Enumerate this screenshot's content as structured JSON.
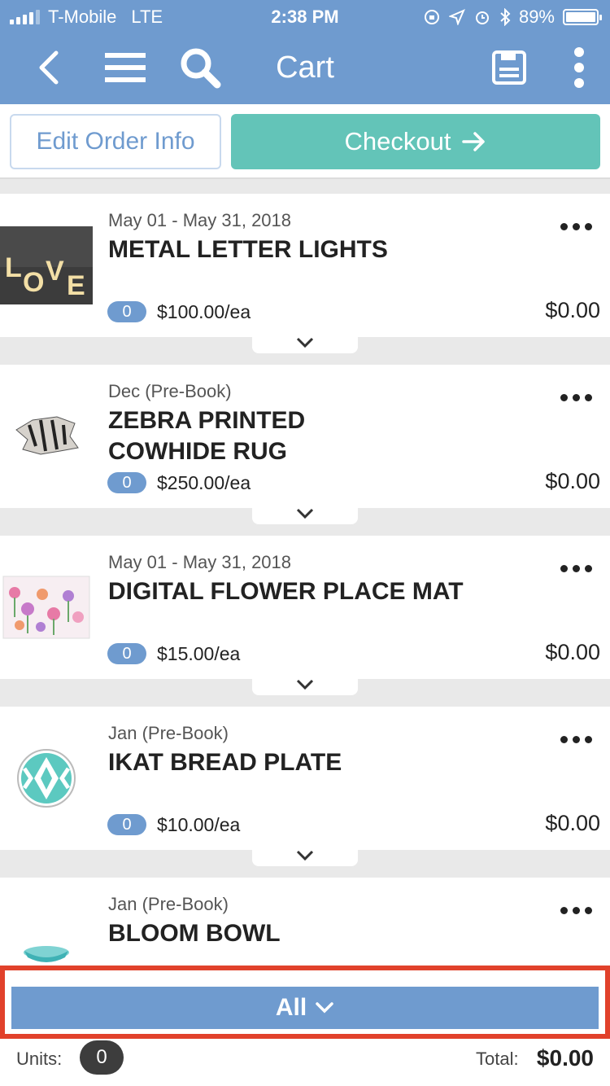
{
  "status": {
    "carrier": "T-Mobile",
    "network": "LTE",
    "time": "2:38 PM",
    "battery": "89%",
    "battery_level": 0.89
  },
  "nav": {
    "title": "Cart"
  },
  "actions": {
    "edit_label": "Edit Order Info",
    "checkout_label": "Checkout"
  },
  "items": [
    {
      "period": "May 01 - May 31, 2018",
      "name": "METAL LETTER LIGHTS",
      "qty": "0",
      "price": "$100.00/ea",
      "total": "$0.00"
    },
    {
      "period": "Dec (Pre-Book)",
      "name": "ZEBRA PRINTED COWHIDE RUG",
      "qty": "0",
      "price": "$250.00/ea",
      "total": "$0.00"
    },
    {
      "period": "May 01 - May 31, 2018",
      "name": "DIGITAL FLOWER PLACE MAT",
      "qty": "0",
      "price": "$15.00/ea",
      "total": "$0.00"
    },
    {
      "period": "Jan (Pre-Book)",
      "name": "IKAT BREAD PLATE",
      "qty": "0",
      "price": "$10.00/ea",
      "total": "$0.00"
    },
    {
      "period": "Jan (Pre-Book)",
      "name": "BLOOM BOWL",
      "qty": "",
      "price": "",
      "total": ""
    }
  ],
  "filter": {
    "label": "All"
  },
  "footer": {
    "units_label": "Units:",
    "units_value": "0",
    "total_label": "Total:",
    "total_value": "$0.00"
  },
  "colors": {
    "header": "#6f9bcf",
    "checkout": "#63c4b8",
    "highlight": "#e1412b"
  }
}
